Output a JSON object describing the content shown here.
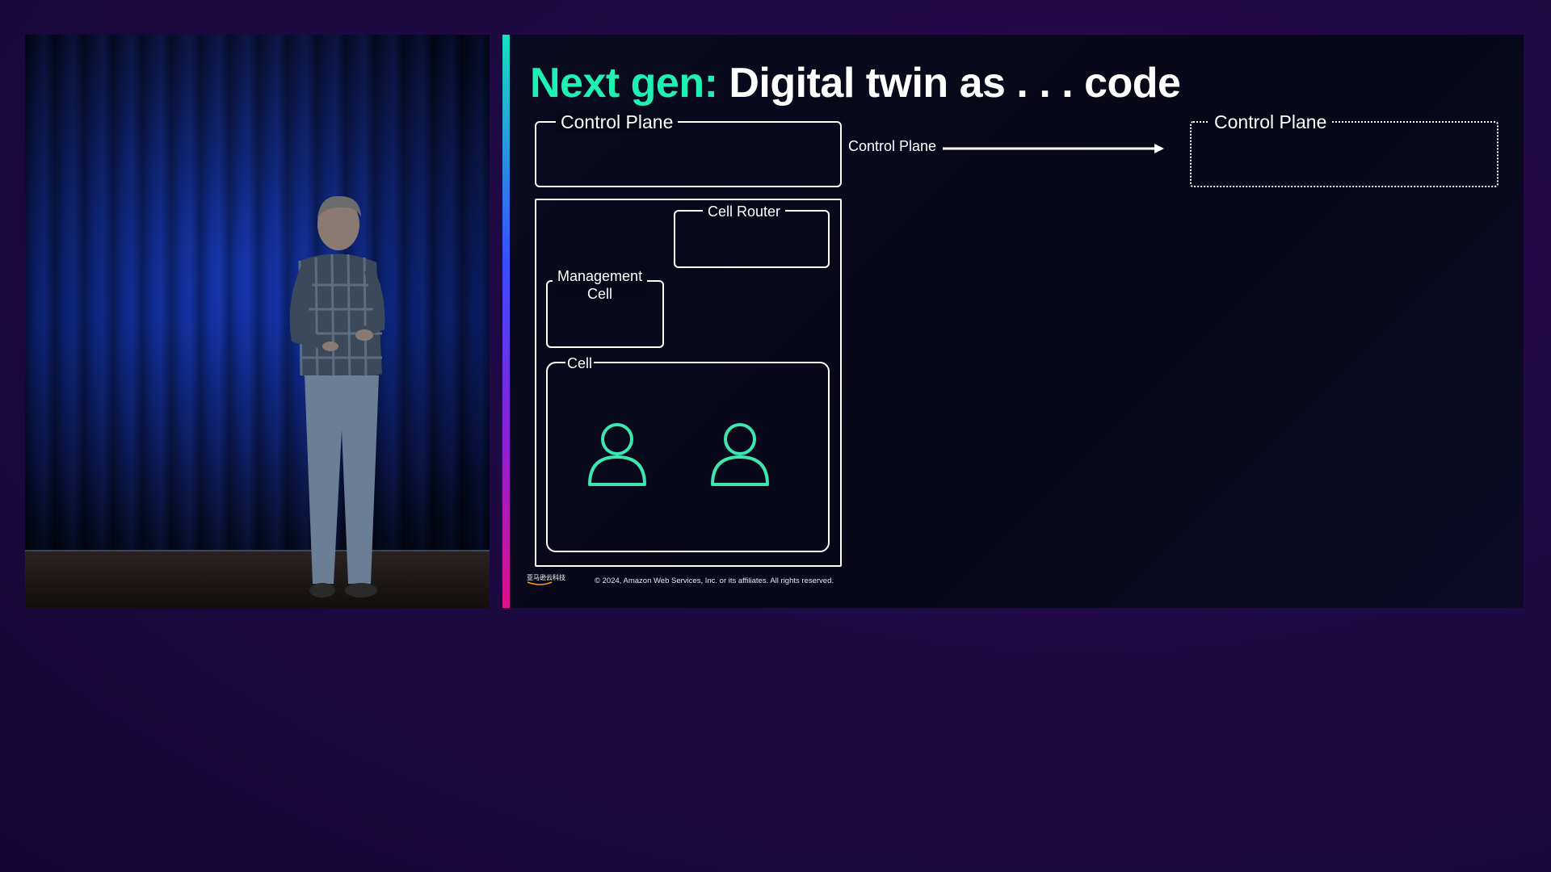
{
  "slide": {
    "title_accent": "Next gen:",
    "title_rest": " Digital twin as . . . code",
    "control_plane_label": "Control Plane",
    "cell_router_label": "Cell Router",
    "management_cell_line1": "Management",
    "management_cell_line2": "Cell",
    "cell_label": "Cell",
    "arrow_label": "Control Plane",
    "target_control_plane_label": "Control Plane",
    "logo_text": "亚马逊云科技",
    "copyright": "© 2024, Amazon Web Services, Inc. or its affiliates. All rights reserved."
  },
  "colors": {
    "accent": "#1ff0b4",
    "user_icon": "#3ee6b0",
    "text": "#ffffff"
  },
  "icons": [
    "user-icon",
    "user-icon",
    "arrow-right-icon"
  ]
}
